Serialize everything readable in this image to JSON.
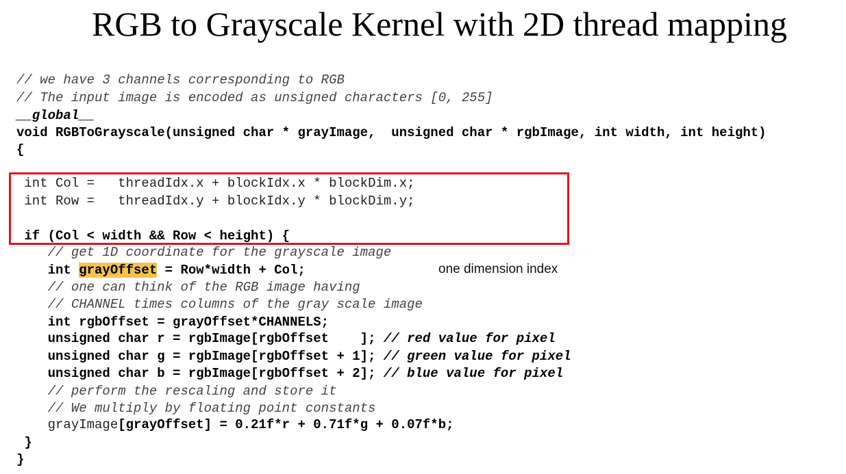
{
  "title": "RGB to Grayscale Kernel with 2D thread mapping",
  "annotation": "one dimension index",
  "colors": {
    "highlight_box": "#e0141e",
    "highlight_word": "#f4c24d"
  },
  "code": {
    "comment1": "// we have 3 channels corresponding to RGB",
    "comment2": "// The input image is encoded as unsigned characters [0, 255]",
    "global": "__global__",
    "signature": "void RGBToGrayscale(unsigned char * grayImage,  unsigned char * rgbImage, int width, int height)",
    "open_brace": "{",
    "col_line": " int Col =   threadIdx.x + blockIdx.x * blockDim.x;",
    "row_line": " int Row =   threadIdx.y + blockIdx.y * blockDim.y;",
    "if_line": " if (Col < width && Row < height) {",
    "comment_1d": "    // get 1D coordinate for the grayscale image",
    "gray_offset_pre": "    int ",
    "gray_offset_var": "grayOffset",
    "gray_offset_post": " = Row*width + Col;",
    "comment_rgb1": "    // one can think of the RGB image having",
    "comment_rgb2": "    // CHANNEL times columns of the gray scale image",
    "rgb_offset": "    int rgbOffset = grayOffset*CHANNELS;",
    "r_code": "    unsigned char r = rgbImage[rgbOffset    ]; ",
    "r_comment": "// red value for pixel",
    "g_code": "    unsigned char g = rgbImage[rgbOffset + 1]; ",
    "g_comment": "// green value for pixel",
    "b_code": "    unsigned char b = rgbImage[rgbOffset + 2]; ",
    "b_comment": "// blue value for pixel",
    "comment_rescale": "    // perform the rescaling and store it",
    "comment_multiply": "    // We multiply by floating point constants",
    "gray_assign_pre": "    grayImage",
    "gray_assign_post": "[grayOffset] = 0.21f*r + 0.71f*g + 0.07f*b;",
    "close_inner": " }",
    "close_outer": "}"
  }
}
